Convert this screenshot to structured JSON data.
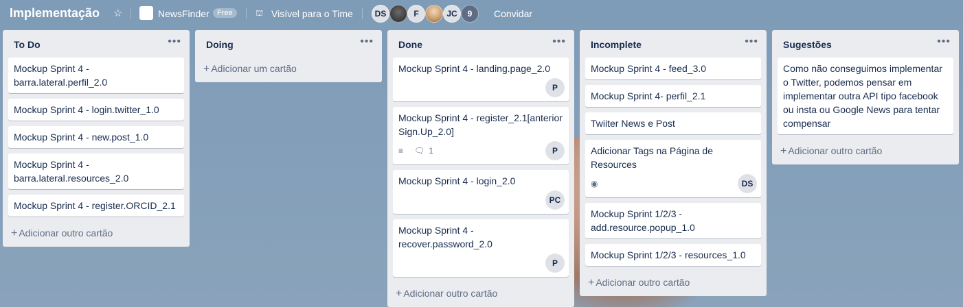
{
  "header": {
    "board_title": "Implementação",
    "team_name": "NewsFinder",
    "plan_badge": "Free",
    "visibility": "Visível para o Time",
    "members": [
      "DS",
      "",
      "F",
      "",
      "JC"
    ],
    "more_members": "9",
    "invite": "Convidar"
  },
  "lists": [
    {
      "title": "To Do",
      "cards": [
        {
          "title": "Mockup Sprint 4 - barra.lateral.perfil_2.0"
        },
        {
          "title": "Mockup Sprint 4 - login.twitter_1.0"
        },
        {
          "title": "Mockup Sprint 4 - new.post_1.0"
        },
        {
          "title": "Mockup Sprint 4 - barra.lateral.resources_2.0"
        },
        {
          "title": "Mockup Sprint 4 - register.ORCID_2.1"
        }
      ],
      "add_label": "Adicionar outro cartão"
    },
    {
      "title": "Doing",
      "cards": [],
      "add_label": "Adicionar um cartão"
    },
    {
      "title": "Done",
      "cards": [
        {
          "title": "Mockup Sprint 4 - landing.page_2.0",
          "member": "P"
        },
        {
          "title": "Mockup Sprint 4 - register_2.1[anterior Sign.Up_2.0]",
          "member": "P",
          "comments": "1"
        },
        {
          "title": "Mockup Sprint 4 - login_2.0",
          "member": "PC"
        },
        {
          "title": "Mockup Sprint 4 - recover.password_2.0",
          "member": "P"
        }
      ],
      "add_label": "Adicionar outro cartão"
    },
    {
      "title": "Incomplete",
      "cards": [
        {
          "title": "Mockup Sprint 4 - feed_3.0"
        },
        {
          "title": "Mockup Sprint 4- perfil_2.1"
        },
        {
          "title": "Twiiter News e Post"
        },
        {
          "title": "Adicionar Tags na Página de Resources",
          "member": "DS"
        },
        {
          "title": "Mockup Sprint 1/2/3 - add.resource.popup_1.0"
        },
        {
          "title": "Mockup Sprint 1/2/3 - resources_1.0"
        }
      ],
      "add_label": "Adicionar outro cartão"
    },
    {
      "title": "Sugestões",
      "cards": [
        {
          "title": "Como não conseguimos implementar o Twitter, podemos pensar em implementar outra API tipo facebook ou insta ou Google News para tentar compensar"
        }
      ],
      "add_label": "Adicionar outro cartão"
    }
  ],
  "icons": {
    "star": "star-icon",
    "visibility": "team-visibility-icon",
    "description": "description-icon",
    "comment": "comment-icon",
    "watch": "eye-icon",
    "menu": "more-icon"
  }
}
